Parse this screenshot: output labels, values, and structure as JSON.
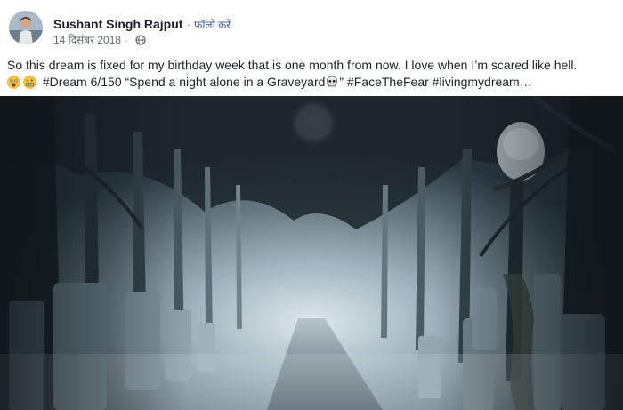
{
  "post": {
    "author": "Sushant Singh Rajput",
    "separator": "·",
    "follow_label": "फ़ॉलो करें",
    "date": "14 दिसंबर 2018",
    "privacy_icon": "globe-icon"
  },
  "caption": {
    "line1": "So this dream is fixed for my birthday week that is one month from now. I love when I’m scared like hell.",
    "line2_a": "#Dream 6/150 “Spend a night alone in a Graveyard",
    "line2_b": "” #FaceTheFear #livingmydream…",
    "emojis": [
      "scared-face-emoji",
      "grimacing-face-emoji",
      "skull-emoji"
    ]
  },
  "photo": {
    "subject": "misty-graveyard-photo",
    "colors": {
      "sky": "#c6d6df",
      "fog": "#8fa7b3",
      "trees": "#1c2328",
      "path": "#9aa8b0"
    }
  }
}
